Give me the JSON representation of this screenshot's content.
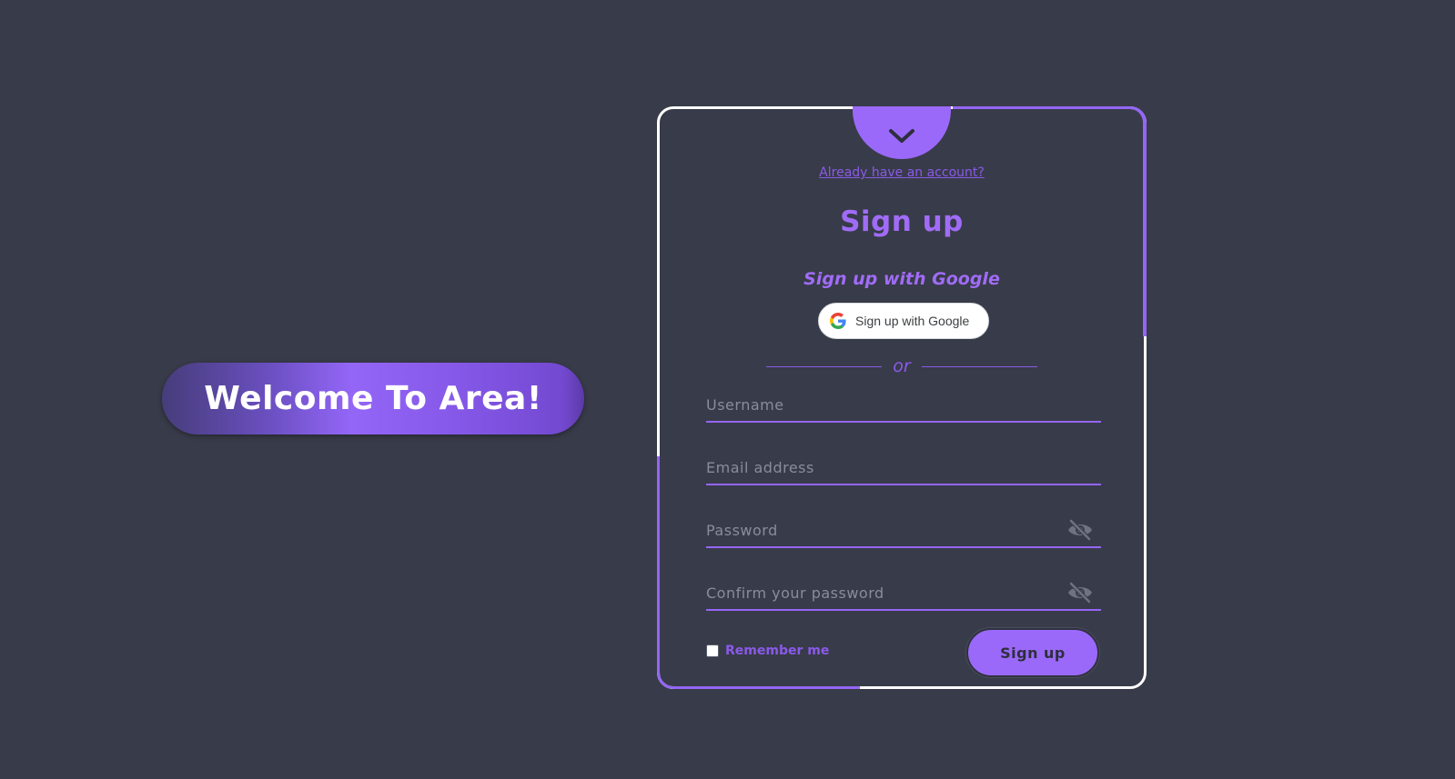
{
  "welcome": {
    "title": "Welcome To Area!"
  },
  "card": {
    "toggle_icon": "chevron-down-icon",
    "already_link": "Already have an account?",
    "title": "Sign up",
    "google_heading": "Sign up with Google",
    "google_button_label": "Sign up with Google",
    "google_icon": "google-logo-icon",
    "divider_text": "or",
    "fields": {
      "username": {
        "placeholder": "Username",
        "value": ""
      },
      "email": {
        "placeholder": "Email address",
        "value": ""
      },
      "password": {
        "placeholder": "Password",
        "value": "",
        "toggle_icon": "eye-off-icon"
      },
      "confirm_password": {
        "placeholder": "Confirm your password",
        "value": "",
        "toggle_icon": "eye-off-icon"
      }
    },
    "remember_label": "Remember me",
    "remember_checked": false,
    "submit_label": "Sign up"
  },
  "colors": {
    "background": "#383b49",
    "accent": "#9b69f9",
    "accent_text": "#a06cf7",
    "card_border": "#ffffff"
  }
}
